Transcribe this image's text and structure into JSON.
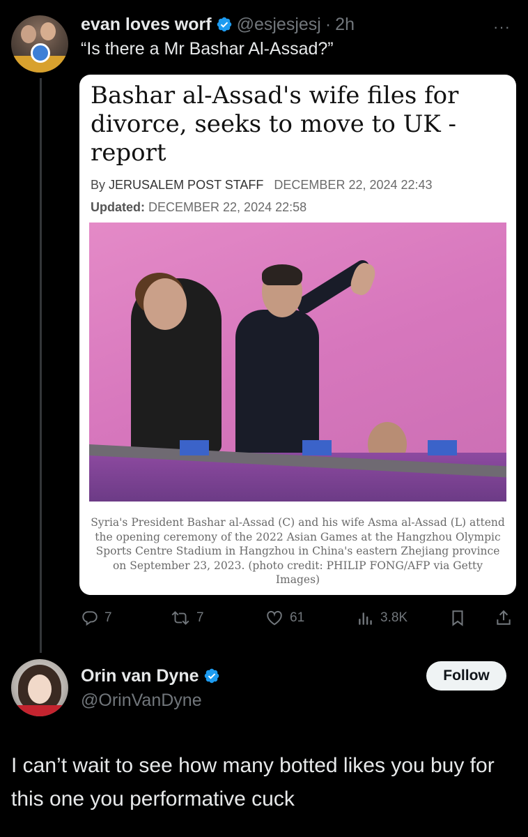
{
  "tweet": {
    "display_name": "evan loves worf",
    "handle": "@esjesjesj",
    "separator": "·",
    "time": "2h",
    "more": "···",
    "text": "“Is there a Mr Bashar Al-Assad?”"
  },
  "article": {
    "headline": "Bashar al-Assad's wife files for divorce, seeks to move to UK - report",
    "byline_prefix": "By",
    "byline_author": "JERUSALEM POST STAFF",
    "published": "DECEMBER 22, 2024 22:43",
    "updated_label": "Updated:",
    "updated": "DECEMBER 22, 2024 22:58",
    "caption": "Syria's President Bashar al-Assad (C) and his wife Asma al-Assad (L) attend the opening ceremony of the 2022 Asian Games at the Hangzhou Olympic Sports Centre Stadium in Hangzhou in China's eastern Zhejiang province on September 23, 2023. (photo credit: PHILIP FONG/AFP via Getty Images)"
  },
  "actions": {
    "replies": "7",
    "reposts": "7",
    "likes": "61",
    "views": "3.8K"
  },
  "reply": {
    "display_name": "Orin van Dyne",
    "handle": "@OrinVanDyne",
    "follow_label": "Follow",
    "text": "I can’t wait to see how many botted likes you buy for this one you performative cuck"
  },
  "colors": {
    "background": "#000000",
    "text": "#e7e9ea",
    "muted": "#71767b",
    "verified": "#1d9bf0",
    "follow_bg": "#eff3f4"
  },
  "icons": [
    "verified-badge-icon",
    "more-icon",
    "reply-icon",
    "repost-icon",
    "like-icon",
    "views-icon",
    "bookmark-icon",
    "share-icon"
  ]
}
